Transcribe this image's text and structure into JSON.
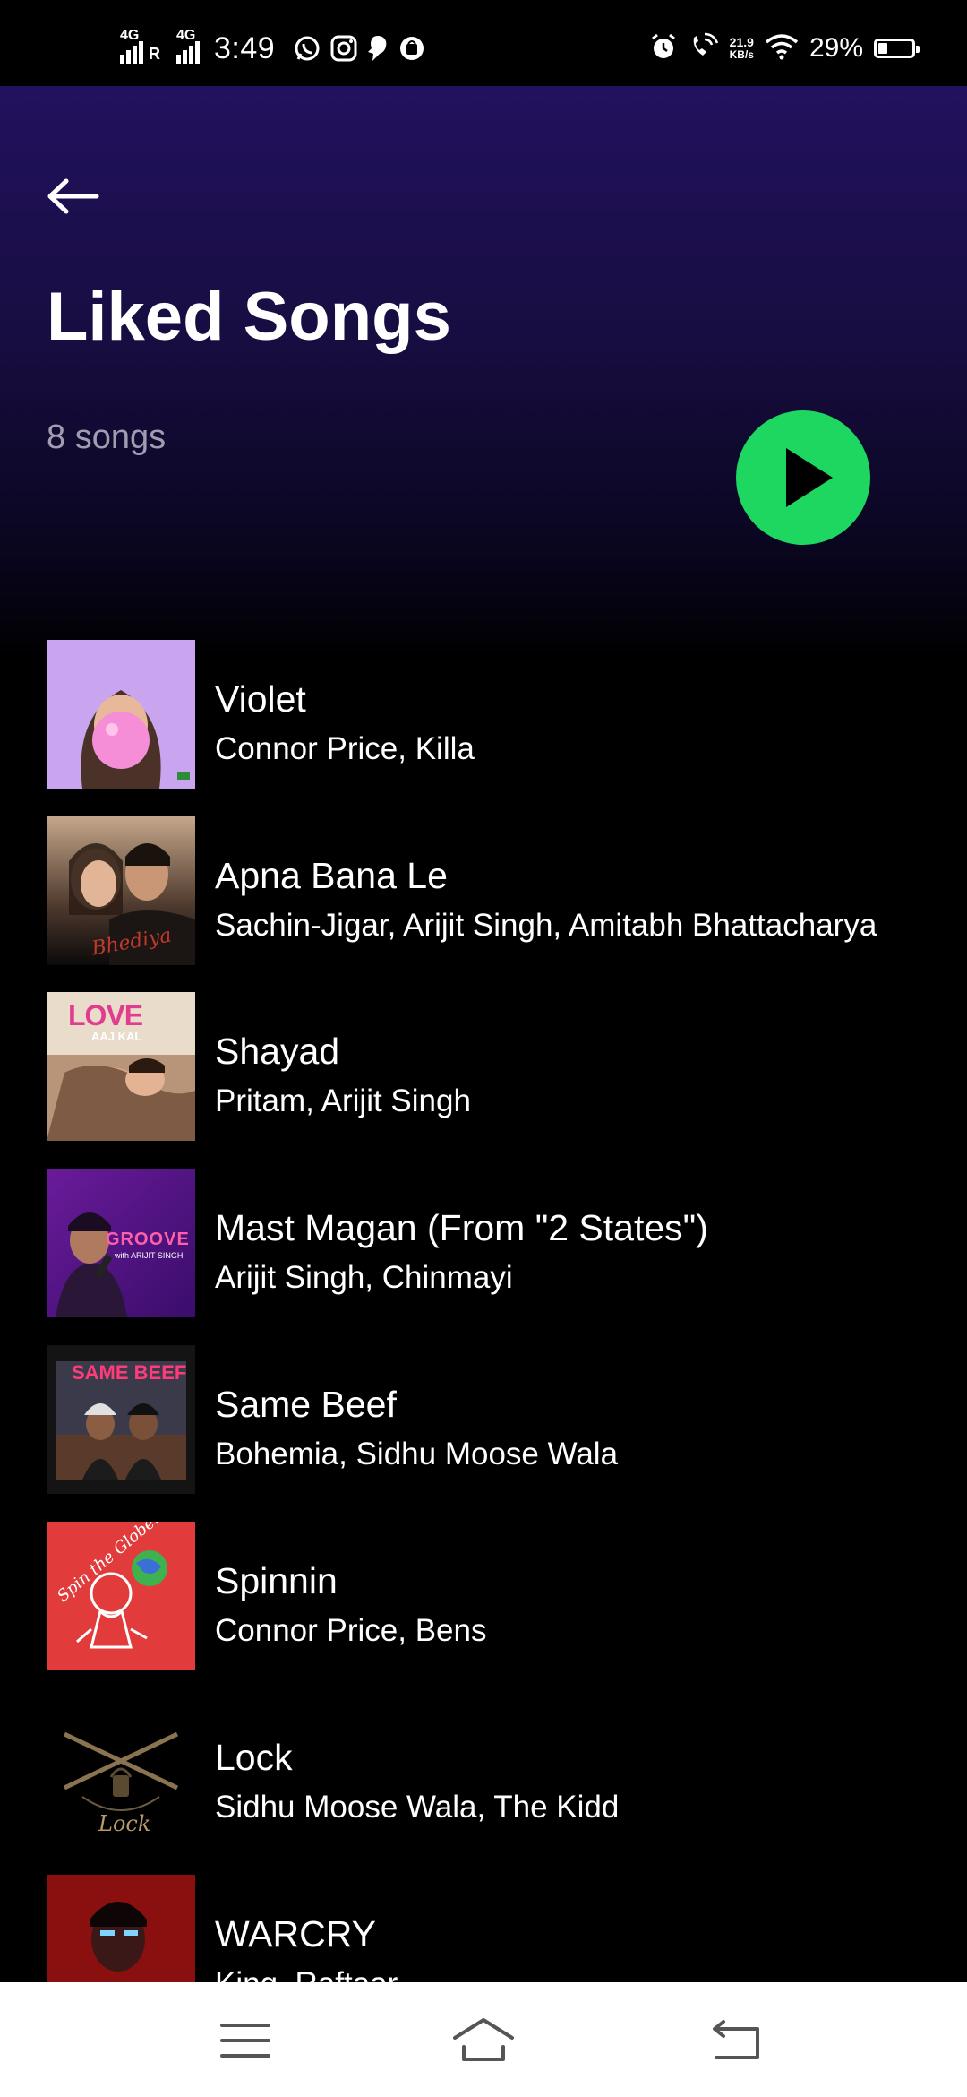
{
  "status_bar": {
    "sim1_label": "4G",
    "roaming_label": "R",
    "sim2_label": "4G",
    "time": "3:49",
    "notification_icons": [
      "whatsapp-icon",
      "instagram-icon",
      "snapchat-icon",
      "app-icon"
    ],
    "net_speed_value": "21.9",
    "net_speed_unit": "KB/s",
    "battery_percent": "29%",
    "battery_level": 0.29
  },
  "header": {
    "back_icon": "arrow-left-icon",
    "title": "Liked Songs",
    "song_count": "8 songs",
    "play_icon": "play-icon",
    "play_color": "#1ed760"
  },
  "songs": [
    {
      "title": "Violet",
      "artist": "Connor Price, Killa"
    },
    {
      "title": "Apna Bana Le",
      "artist": "Sachin-Jigar, Arijit Singh, Amitabh Bhattacharya"
    },
    {
      "title": "Shayad",
      "artist": "Pritam, Arijit Singh"
    },
    {
      "title": "Mast Magan (From \"2 States\")",
      "artist": "Arijit Singh, Chinmayi"
    },
    {
      "title": "Same Beef",
      "artist": "Bohemia, Sidhu Moose Wala"
    },
    {
      "title": "Spinnin",
      "artist": "Connor Price, Bens"
    },
    {
      "title": "Lock",
      "artist": "Sidhu Moose Wala, The Kidd"
    },
    {
      "title": "WARCRY",
      "artist": "King, Raftaar"
    }
  ],
  "covers": [
    {
      "name": "cover-violet",
      "caption": ""
    },
    {
      "name": "cover-apna-bana-le",
      "caption": "Bhediya"
    },
    {
      "name": "cover-shayad",
      "caption_line1": "LOVE",
      "caption_line2": "AAJ KAL"
    },
    {
      "name": "cover-mast-magan",
      "caption_line1": "GROOVE",
      "caption_line2": "with ARIJIT SINGH"
    },
    {
      "name": "cover-same-beef",
      "caption": "SAME BEEF"
    },
    {
      "name": "cover-spinnin",
      "caption": "Spin the Globe!"
    },
    {
      "name": "cover-lock",
      "caption": "Lock"
    },
    {
      "name": "cover-warcry",
      "caption": ""
    }
  ],
  "nav_bar": {
    "menu_icon": "menu-icon",
    "home_icon": "home-icon",
    "back_icon": "back-icon"
  }
}
